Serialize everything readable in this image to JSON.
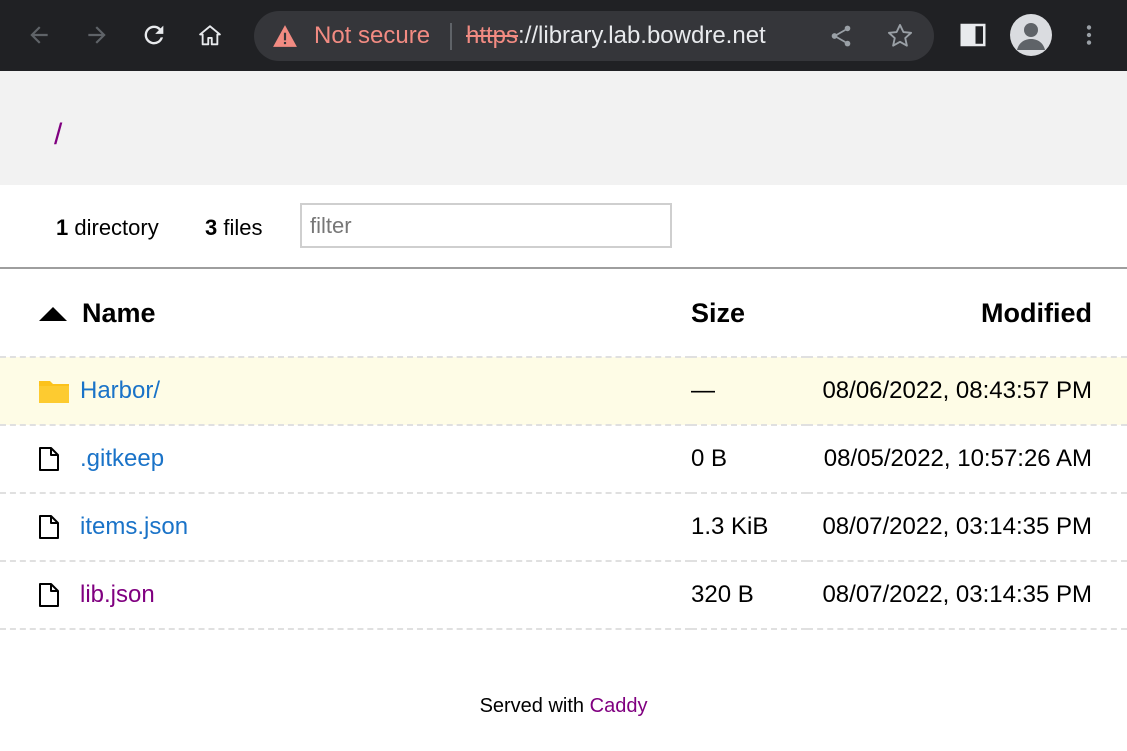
{
  "browser": {
    "security_label": "Not secure",
    "url_scheme": "https",
    "url_rest": "://library.lab.bowdre.net"
  },
  "page": {
    "breadcrumb": "/",
    "directory_count": "1",
    "directory_label": "directory",
    "file_count": "3",
    "files_label": "files",
    "filter_placeholder": "filter"
  },
  "table": {
    "headers": {
      "name": "Name",
      "size": "Size",
      "modified": "Modified"
    },
    "rows": [
      {
        "name": "Harbor/",
        "type": "folder",
        "size": "—",
        "modified": "08/06/2022, 08:43:57 PM"
      },
      {
        "name": ".gitkeep",
        "type": "file",
        "size": "0 B",
        "modified": "08/05/2022, 10:57:26 AM"
      },
      {
        "name": "items.json",
        "type": "file",
        "size": "1.3 KiB",
        "modified": "08/07/2022, 03:14:35 PM"
      },
      {
        "name": "lib.json",
        "type": "file",
        "size": "320 B",
        "modified": "08/07/2022, 03:14:35 PM"
      }
    ]
  },
  "footer": {
    "prefix": "Served with",
    "link": "Caddy"
  },
  "colors": {
    "chrome_bg": "#202124",
    "omnibox_bg": "#35363a",
    "warning": "#f28b82",
    "link_blue": "#1a73c8",
    "link_visited": "#800080",
    "folder_yellow": "#fcc21b",
    "highlight_row": "#fefce6"
  }
}
